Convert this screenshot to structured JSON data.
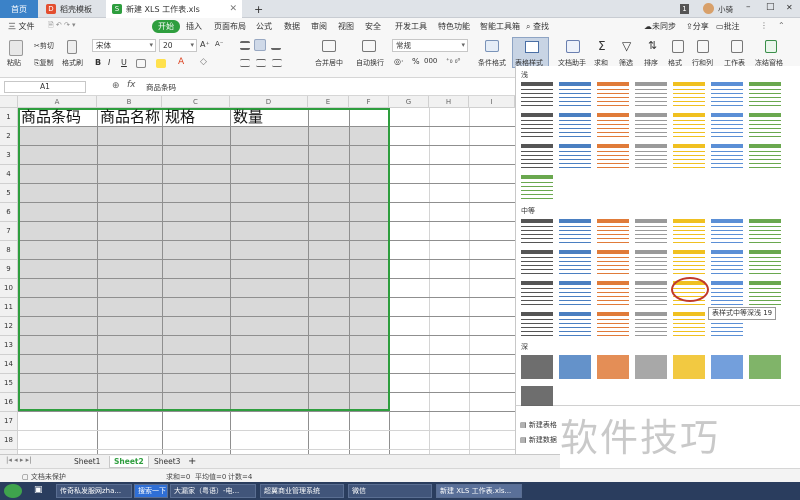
{
  "tabs": {
    "home": "首页",
    "template": "稻壳模板",
    "workbook": "新建 XLS 工作表.xls",
    "new_tab": "+"
  },
  "window": {
    "badge": "1",
    "user": "小骑",
    "min": "–",
    "max": "□",
    "close": "✕"
  },
  "menu": {
    "file": "三 文件",
    "items": [
      "开始",
      "插入",
      "页面布局",
      "公式",
      "数据",
      "审阅",
      "视图",
      "安全",
      "开发工具",
      "特色功能",
      "智能工具箱"
    ],
    "search": "查找",
    "sync": "未同步",
    "share": "分享",
    "comment": "批注"
  },
  "toolbar": {
    "paste": "粘贴",
    "cut": "剪切",
    "copy": "复制",
    "format_painter": "格式刷",
    "font": "宋体",
    "size": "20",
    "bold": "B",
    "italic": "I",
    "underline": "U",
    "font_grow": "A⁺",
    "font_shrink": "A⁻",
    "merge": "合并居中",
    "wrap": "自动换行",
    "number_format": "常规",
    "conditional": "条件格式",
    "table_style": "表格样式",
    "doc_helper": "文档助手",
    "sum": "求和",
    "filter": "筛选",
    "sort": "排序",
    "format": "格式",
    "rows_cols": "行和列",
    "worksheet": "工作表",
    "freeze": "冻结窗格",
    "percent": "%",
    "thousands": "000"
  },
  "formula_bar": {
    "name_box": "A1",
    "fx": "fx",
    "content": "商品条码"
  },
  "grid": {
    "columns": [
      "A",
      "B",
      "C",
      "D",
      "E",
      "F",
      "G",
      "H",
      "I"
    ],
    "rows": [
      "1",
      "2",
      "3",
      "4",
      "5",
      "6",
      "7",
      "8",
      "9",
      "10",
      "11",
      "12",
      "13",
      "14",
      "15",
      "16",
      "17",
      "18",
      "19"
    ],
    "header_cells": [
      "商品条码",
      "商品名称",
      "规格",
      "数量"
    ]
  },
  "style_panel": {
    "light": "浅",
    "medium": "中等",
    "dark": "深",
    "tooltip": "表样式中等深浅 19",
    "new_table_style": "新建表格",
    "new_pivot_style": "新建数据"
  },
  "sheets": [
    "Sheet1",
    "Sheet2",
    "Sheet3"
  ],
  "active_sheet": "Sheet2",
  "status": {
    "doc": "文档未保护",
    "sum": "求和=0",
    "avg": "平均值=0",
    "count": "计数=4"
  },
  "taskbar": {
    "search": "搜索一下",
    "items": [
      "传奇私发服网zha...",
      "大漏家（粤语）-电...",
      "超翼商业管理系统",
      "微信",
      "新建 XLS 工作表.xls..."
    ]
  },
  "watermark": "软件技巧",
  "colors": {
    "accent_green": "#2e9e3e",
    "selection_border": "#2e9e3e",
    "cell_fill": "#d9d9d9",
    "circle": "#c0392b"
  }
}
